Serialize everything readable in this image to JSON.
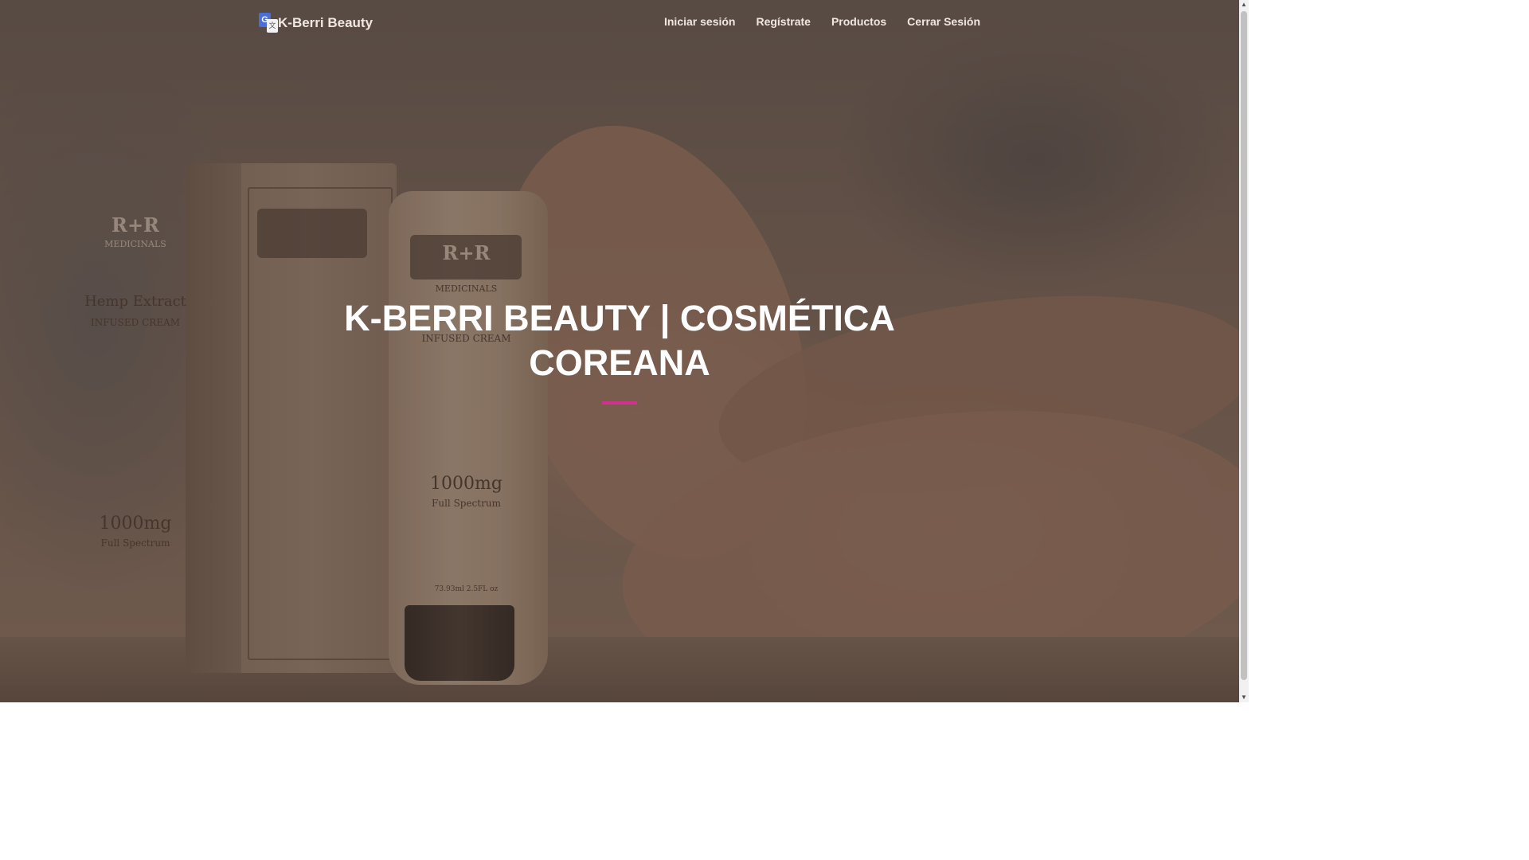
{
  "header": {
    "brand_name": "K-Berri Beauty",
    "brand_icon": "google-translate-icon",
    "nav": [
      {
        "label": "Iniciar sesión"
      },
      {
        "label": "Regístrate"
      },
      {
        "label": "Productos"
      },
      {
        "label": "Cerrar Sesión"
      }
    ]
  },
  "hero": {
    "title_line1": "K-BERRI BEAUTY | COSMÉTICA",
    "title_line2": "COREANA",
    "divider_color": "#d2328f",
    "image": {
      "box_brand": "R+R",
      "box_subbrand": "MEDICINALS",
      "box_product": "Hemp Extract",
      "box_product_sub": "INFUSED CREAM",
      "box_dose": "1000mg",
      "box_spectrum": "Full Spectrum",
      "tube_brand": "R+R",
      "tube_subbrand": "MEDICINALS",
      "tube_product_sub": "INFUSED CREAM",
      "tube_dose": "1000mg",
      "tube_spectrum": "Full Spectrum",
      "tube_volume": "73.93ml 2.5FL oz"
    }
  },
  "colors": {
    "nav_text": "#f1e7e2",
    "accent": "#d2328f",
    "overlay": "rgba(60, 42, 36, 0.45)"
  },
  "scrollbar": {
    "up_arrow": "▲",
    "down_arrow": "▼"
  }
}
